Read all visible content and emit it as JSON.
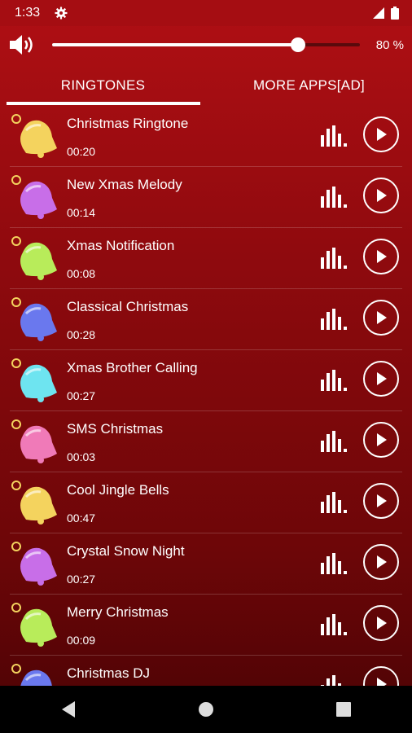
{
  "status_bar": {
    "time": "1:33"
  },
  "volume": {
    "level": 0.8,
    "percent_text": "80 %"
  },
  "tabs": [
    {
      "label": "RINGTONES",
      "active": true
    },
    {
      "label": "MORE APPS[AD]",
      "active": false
    }
  ],
  "ringtones": [
    {
      "title": "Christmas Ringtone",
      "duration": "00:20",
      "bell_color": "#f4d35e"
    },
    {
      "title": "New Xmas Melody",
      "duration": "00:14",
      "bell_color": "#c86ee8"
    },
    {
      "title": "Xmas Notification",
      "duration": "00:08",
      "bell_color": "#b8ec5a"
    },
    {
      "title": "Classical Christmas",
      "duration": "00:28",
      "bell_color": "#6a78ee"
    },
    {
      "title": "Xmas Brother Calling",
      "duration": "00:27",
      "bell_color": "#6ee4f0"
    },
    {
      "title": "SMS Christmas",
      "duration": "00:03",
      "bell_color": "#f07ab8"
    },
    {
      "title": "Cool Jingle Bells",
      "duration": "00:47",
      "bell_color": "#f4d35e"
    },
    {
      "title": "Crystal Snow Night",
      "duration": "00:27",
      "bell_color": "#c86ee8"
    },
    {
      "title": "Merry Christmas",
      "duration": "00:09",
      "bell_color": "#b8ec5a"
    },
    {
      "title": "Christmas DJ",
      "duration": "",
      "bell_color": "#6a78ee"
    }
  ],
  "colors": {
    "accent_red": "#a50d12",
    "text": "#ffffff"
  }
}
